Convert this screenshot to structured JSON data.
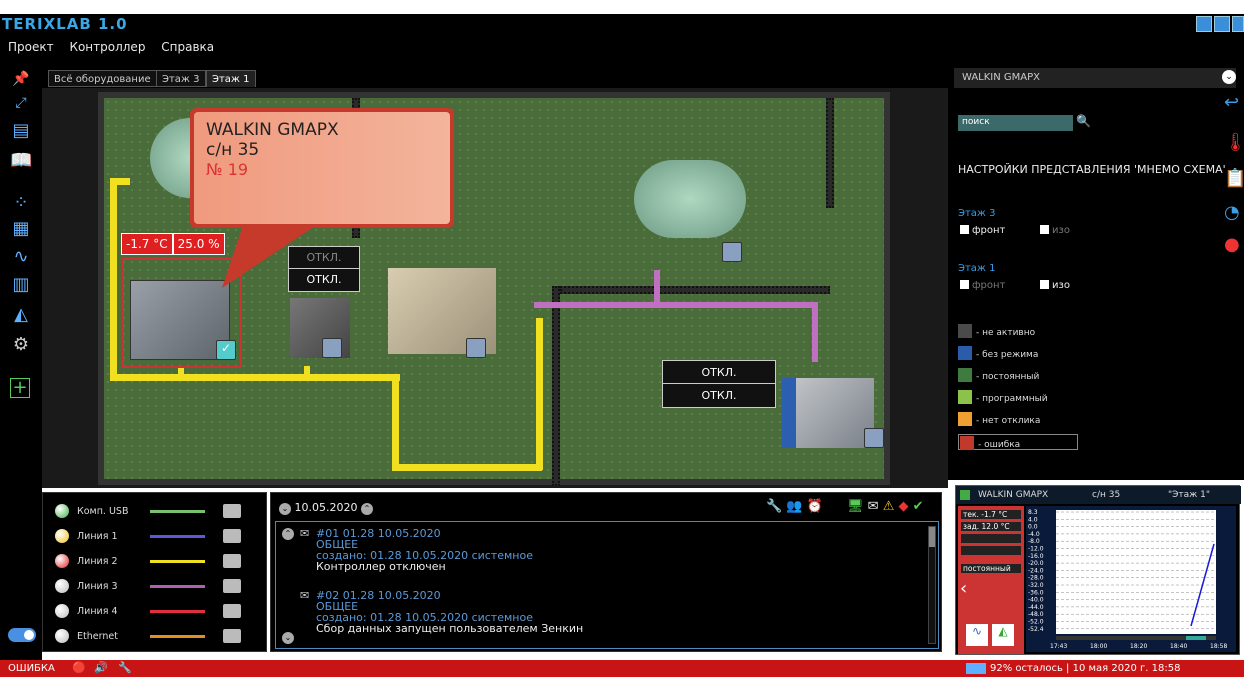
{
  "app": {
    "title": "TERIXLAB 1.0"
  },
  "menu": [
    "Проект",
    "Контроллер",
    "Справка"
  ],
  "tabs": [
    {
      "label": "Всё оборудование"
    },
    {
      "label": "Этаж 3"
    },
    {
      "label": "Этаж 1",
      "active": true
    }
  ],
  "callout": {
    "name": "WALKIN GMAPX",
    "serial": "с/н 35",
    "number": "№ 19"
  },
  "readout": {
    "temp": "-1.7 °C",
    "humidity": "25.0 %"
  },
  "off_boxes": [
    "ОТКЛ.",
    "ОТКЛ.",
    "ОТКЛ.",
    "ОТКЛ."
  ],
  "right_panel": {
    "header": "WALKIN GMAPX",
    "search_placeholder": "поиск",
    "title": "НАСТРОЙКИ ПРЕДСТАВЛЕНИЯ 'МНЕМО СХЕМА'",
    "floors": [
      {
        "label": "Этаж 3",
        "front": {
          "label": "фронт",
          "checked": true
        },
        "iso": {
          "label": "изо",
          "checked": false
        }
      },
      {
        "label": "Этаж 1",
        "front": {
          "label": "фронт",
          "checked": false
        },
        "iso": {
          "label": "изо",
          "checked": true
        }
      }
    ],
    "legend": [
      {
        "label": "- не активно",
        "color": "#4a4a4a"
      },
      {
        "label": "- без режима",
        "color": "#2a5caa"
      },
      {
        "label": "- постоянный",
        "color": "#3f7a3f"
      },
      {
        "label": "- программный",
        "color": "#8bc34a"
      },
      {
        "label": "- нет отклика",
        "color": "#f0a030"
      },
      {
        "label": "- ошибка",
        "color": "#c0392b"
      }
    ]
  },
  "lines": [
    {
      "label": "Комп. USB",
      "led": "#3cb043",
      "color": "#7ac070"
    },
    {
      "label": "Линия 1",
      "led": "#f0c020",
      "color": "#5a5ad8"
    },
    {
      "label": "Линия 2",
      "led": "#e02020",
      "color": "#f0e020"
    },
    {
      "label": "Линия 3",
      "led": "#bbbbbb",
      "color": "#b060b0"
    },
    {
      "label": "Линия 4",
      "led": "#bbbbbb",
      "color": "#e03040"
    },
    {
      "label": "Ethernet",
      "led": "#bbbbbb",
      "color": "#e09020"
    }
  ],
  "events": {
    "date": "10.05.2020",
    "items": [
      {
        "id": "#01 01.28 10.05.2020",
        "category": "ОБЩЕЕ",
        "meta": "создано: 01.28 10.05.2020 системное",
        "message": "Контроллер отключен"
      },
      {
        "id": "#02 01.28 10.05.2020",
        "category": "ОБЩЕЕ",
        "meta": "создано: 01.28 10.05.2020 системное",
        "message": "Сбор данных запущен пользователем Зенкин"
      }
    ]
  },
  "mini": {
    "name": "WALKIN GMAPX",
    "serial": "с/н 35",
    "floor": "\"Этаж 1\"",
    "rows": [
      "тек. -1.7 °C",
      "зад. 12.0 °C",
      "",
      "",
      "постоянный"
    ],
    "y_ticks": [
      "8.3",
      "4.0",
      "0.0",
      "-4.0",
      "-8.0",
      "-12.0",
      "-16.0",
      "-20.0",
      "-24.0",
      "-28.0",
      "-32.0",
      "-36.0",
      "-40.0",
      "-44.0",
      "-48.0",
      "-52.0",
      "-52.4"
    ],
    "x_ticks": [
      "17:43",
      "18:00",
      "18:20",
      "18:40",
      "18:58"
    ]
  },
  "status": {
    "left": "ОШИБКА",
    "right": "92% осталось | 10 мая 2020 г. 18:58"
  }
}
